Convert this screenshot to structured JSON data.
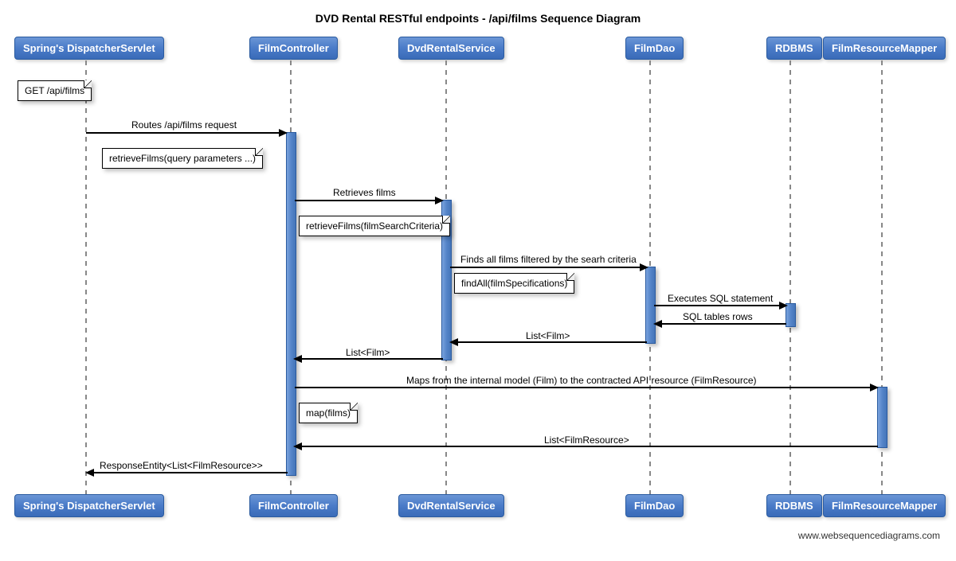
{
  "title": "DVD Rental RESTful endpoints - /api/films Sequence Diagram",
  "participants": {
    "p1": "Spring's DispatcherServlet",
    "p2": "FilmController",
    "p3": "DvdRentalService",
    "p4": "FilmDao",
    "p5": "RDBMS",
    "p6": "FilmResourceMapper"
  },
  "notes": {
    "n1": "GET /api/films",
    "n2": "retrieveFilms(query parameters ...)",
    "n3": "retrieveFilms(filmSearchCriteria)",
    "n4": "findAll(filmSpecifications)",
    "n5": "map(films)"
  },
  "messages": {
    "m1": "Routes /api/films request",
    "m2": "Retrieves films",
    "m3": "Finds all films filtered by the searh criteria",
    "m4": "Executes SQL statement",
    "m5": "SQL tables rows",
    "m6": "List<Film>",
    "m7": "List<Film>",
    "m8": "Maps from the internal model (Film) to the contracted API resource (FilmResource)",
    "m9": "List<FilmResource>",
    "m10": "ResponseEntity<List<FilmResource>>"
  },
  "footer": "www.websequencediagrams.com"
}
